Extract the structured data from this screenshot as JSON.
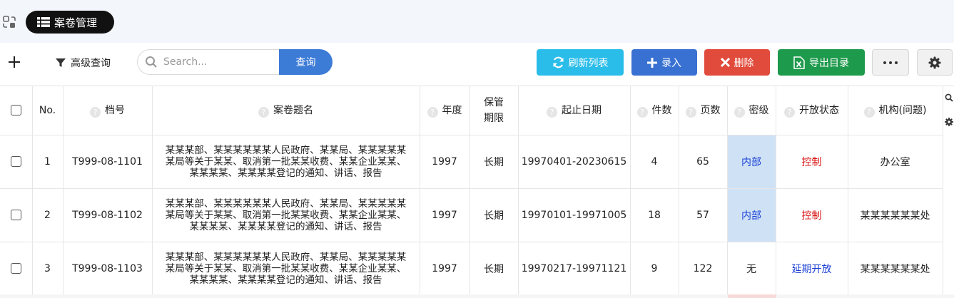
{
  "header": {
    "module_title": "案卷管理",
    "corner_icon": "swap-icon",
    "module_icon": "list-icon"
  },
  "toolbar": {
    "add_icon": "plus-icon",
    "advanced_label": "高级查询",
    "search_placeholder": "Search...",
    "search_button": "查询",
    "refresh_label": "刷新列表",
    "add_label": "录入",
    "delete_label": "删除",
    "export_label": "导出目录",
    "more_icon": "ellipsis-icon",
    "settings_icon": "gear-icon"
  },
  "colors": {
    "pill_bg": "#111111",
    "search_btn": "#3c7bd6",
    "refresh_btn": "#2bbde9",
    "add_btn": "#3871d2",
    "delete_btn": "#e14b3c",
    "export_btn": "#1e9a4c",
    "secret_cell_bg": "#cfe2f5",
    "status_red": "#d8100e",
    "status_blue": "#1a3fd6"
  },
  "table": {
    "columns": [
      "No.",
      "档号",
      "案卷题名",
      "年度",
      "保管期限",
      "起止日期",
      "件数",
      "页数",
      "密级",
      "开放状态",
      "机构(问题)"
    ],
    "rows": [
      {
        "no": "1",
        "code": "T999-08-1101",
        "title": "某某某部、某某某某某某人民政府、某某局、某某某某某某局等关于某某、取消第一批某某收费、某某企业某某、某某某某、某某某某登记的通知、讲话、报告",
        "year": "1997",
        "term": "长期",
        "dates": "19970401-20230615",
        "items": "4",
        "pages": "65",
        "secret": "内部",
        "status": "控制",
        "org": "办公室"
      },
      {
        "no": "2",
        "code": "T999-08-1102",
        "title": "某某某部、某某某某某某人民政府、某某局、某某某某某某局等关于某某、取消第一批某某收费、某某企业某某、某某某某、某某某某登记的通知、讲话、报告",
        "year": "1997",
        "term": "长期",
        "dates": "19970101-19971005",
        "items": "18",
        "pages": "57",
        "secret": "内部",
        "status": "控制",
        "org": "某某某某某某处"
      },
      {
        "no": "3",
        "code": "T999-08-1103",
        "title": "某某某部、某某某某某某人民政府、某某局、某某某某某某局等关于某某、取消第一批某某收费、某某企业某某、某某某某、某某某某登记的通知、讲话、报告",
        "year": "1997",
        "term": "长期",
        "dates": "19970217-19971121",
        "items": "9",
        "pages": "122",
        "secret": "无",
        "status": "延期开放",
        "org": "某某某某某某处"
      }
    ]
  }
}
